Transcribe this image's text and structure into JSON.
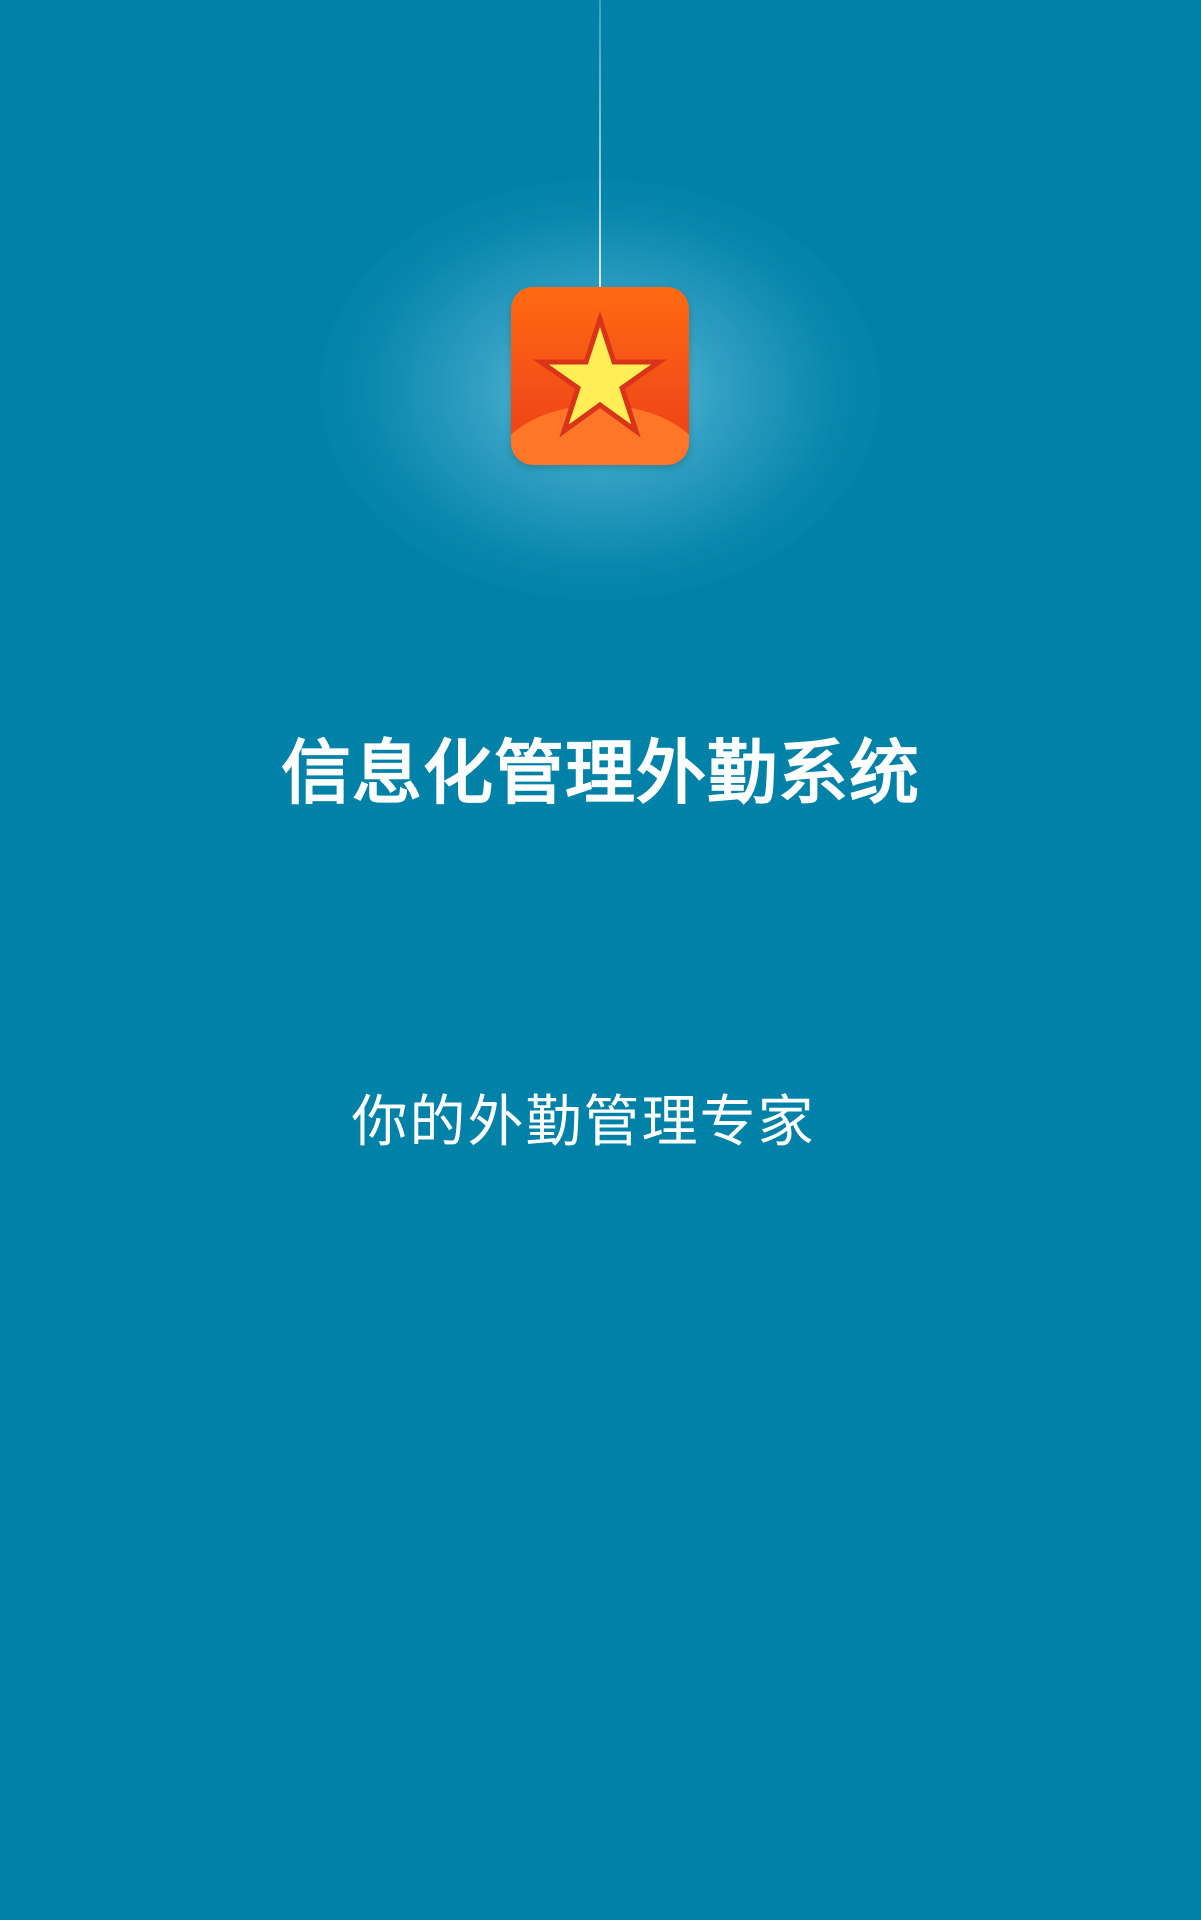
{
  "splash": {
    "app_title": "信息化管理外勤系统",
    "slogan": "你的外勤管理专家",
    "logo_icon": "star-icon"
  },
  "colors": {
    "background": "#0082a8",
    "icon_orange": "#f55018",
    "star_fill": "#ffee55",
    "star_stroke": "#d8341a",
    "text": "#ffffff"
  }
}
